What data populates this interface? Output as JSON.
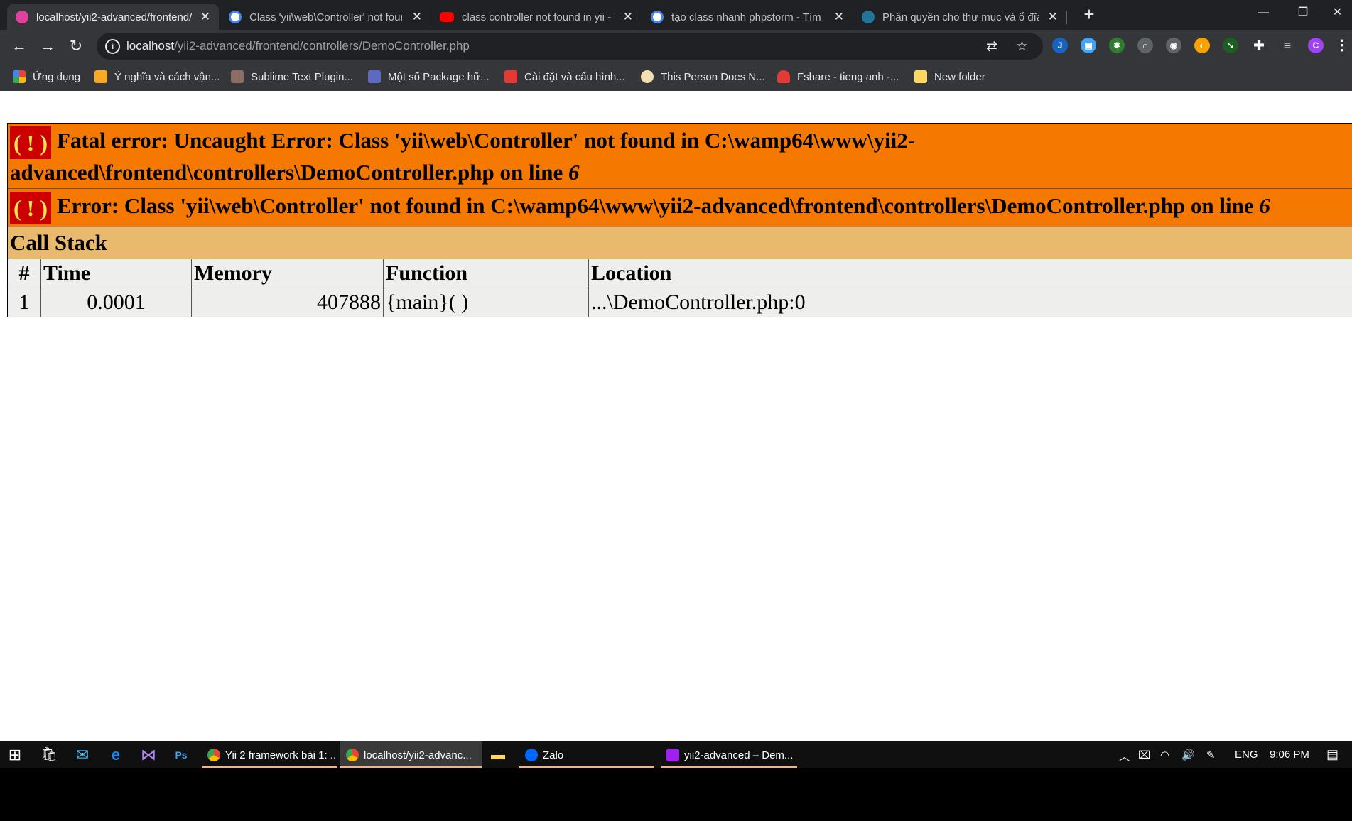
{
  "tabs": [
    {
      "title": "localhost/yii2-advanced/frontend/",
      "active": true,
      "favicon_color": "#e040a0"
    },
    {
      "title": "Class 'yii\\web\\Controller' not found",
      "active": false,
      "favicon_color": "#4285f4"
    },
    {
      "title": "class controller not found in yii - YouTube",
      "active": false,
      "favicon_color": "#ff0000"
    },
    {
      "title": "tạo class nhanh phpstorm - Tìm trên Google",
      "active": false,
      "favicon_color": "#4285f4"
    },
    {
      "title": "Phân quyền cho thư mục và ổ đĩa",
      "active": false,
      "favicon_color": "#21759b"
    }
  ],
  "new_tab_symbol": "+",
  "window_controls": {
    "minimize": "—",
    "restore": "❐",
    "close": "✕"
  },
  "toolbar": {
    "back": "←",
    "forward": "→",
    "reload": "↻",
    "url_host": "localhost",
    "url_path": "/yii2-advanced/frontend/controllers/DemoController.php",
    "profile_initial": "C"
  },
  "extensions": [
    {
      "name": "j-icon",
      "label": "J",
      "color": "#1565c0"
    },
    {
      "name": "picture-icon",
      "label": "▣",
      "color": "#42a5f5"
    },
    {
      "name": "gear-green-icon",
      "label": "✹",
      "color": "#2e7d32"
    },
    {
      "name": "arch-icon",
      "label": "∩",
      "color": "#5f6368"
    },
    {
      "name": "mask-icon",
      "label": "◉",
      "color": "#5f6368"
    },
    {
      "name": "orange-circle-icon",
      "label": "◐",
      "color": "#f4a300"
    },
    {
      "name": "green-arrow-icon",
      "label": "↘",
      "color": "#1b5e20"
    }
  ],
  "bookmarks": [
    {
      "label": "Ứng dụng",
      "color": "#ea4335"
    },
    {
      "label": "Ý nghĩa và cách vận...",
      "color": "#f9a825"
    },
    {
      "label": "Sublime Text Plugin...",
      "color": "#8d6e63"
    },
    {
      "label": "Một số Package hữ...",
      "color": "#5c6bc0"
    },
    {
      "label": "Cài đặt và cấu hình...",
      "color": "#e53935"
    },
    {
      "label": "This Person Does N...",
      "color": "#f5deb3"
    },
    {
      "label": "Fshare - tieng anh -...",
      "color": "#e53935"
    },
    {
      "label": "New folder",
      "color": "#fdd663"
    }
  ],
  "error": {
    "bang": "( ! )",
    "fatal_text": "Fatal error: Uncaught Error: Class 'yii\\web\\Controller' not found in C:\\wamp64\\www\\yii2-advanced\\frontend\\controllers\\DemoController.php",
    "fatal_line_prefix": "on line ",
    "fatal_line_number": "6",
    "error_text": "Error: Class 'yii\\web\\Controller' not found in C:\\wamp64\\www\\yii2-advanced\\frontend\\controllers\\DemoController.php on line ",
    "error_line_number": "6",
    "call_stack_label": "Call Stack",
    "columns": [
      "#",
      "Time",
      "Memory",
      "Function",
      "Location"
    ],
    "rows": [
      {
        "num": "1",
        "time": "0.0001",
        "memory": "407888",
        "function": "{main}( )",
        "location": "...\\DemoController.php:0"
      }
    ]
  },
  "taskbar": {
    "apps": [
      {
        "label": "Yii 2 framework bài 1: ...",
        "color": "#ea4335",
        "active": false,
        "underline": true
      },
      {
        "label": "localhost/yii2-advanc...",
        "color": "#4285f4",
        "active": true,
        "underline": true
      },
      {
        "label": "Zalo",
        "color": "#0068ff",
        "active": false,
        "underline": true
      },
      {
        "label": "yii2-advanced – Dem...",
        "color": "#a020f0",
        "active": false,
        "underline": true
      }
    ],
    "language": "ENG",
    "time": "9:06 PM"
  }
}
